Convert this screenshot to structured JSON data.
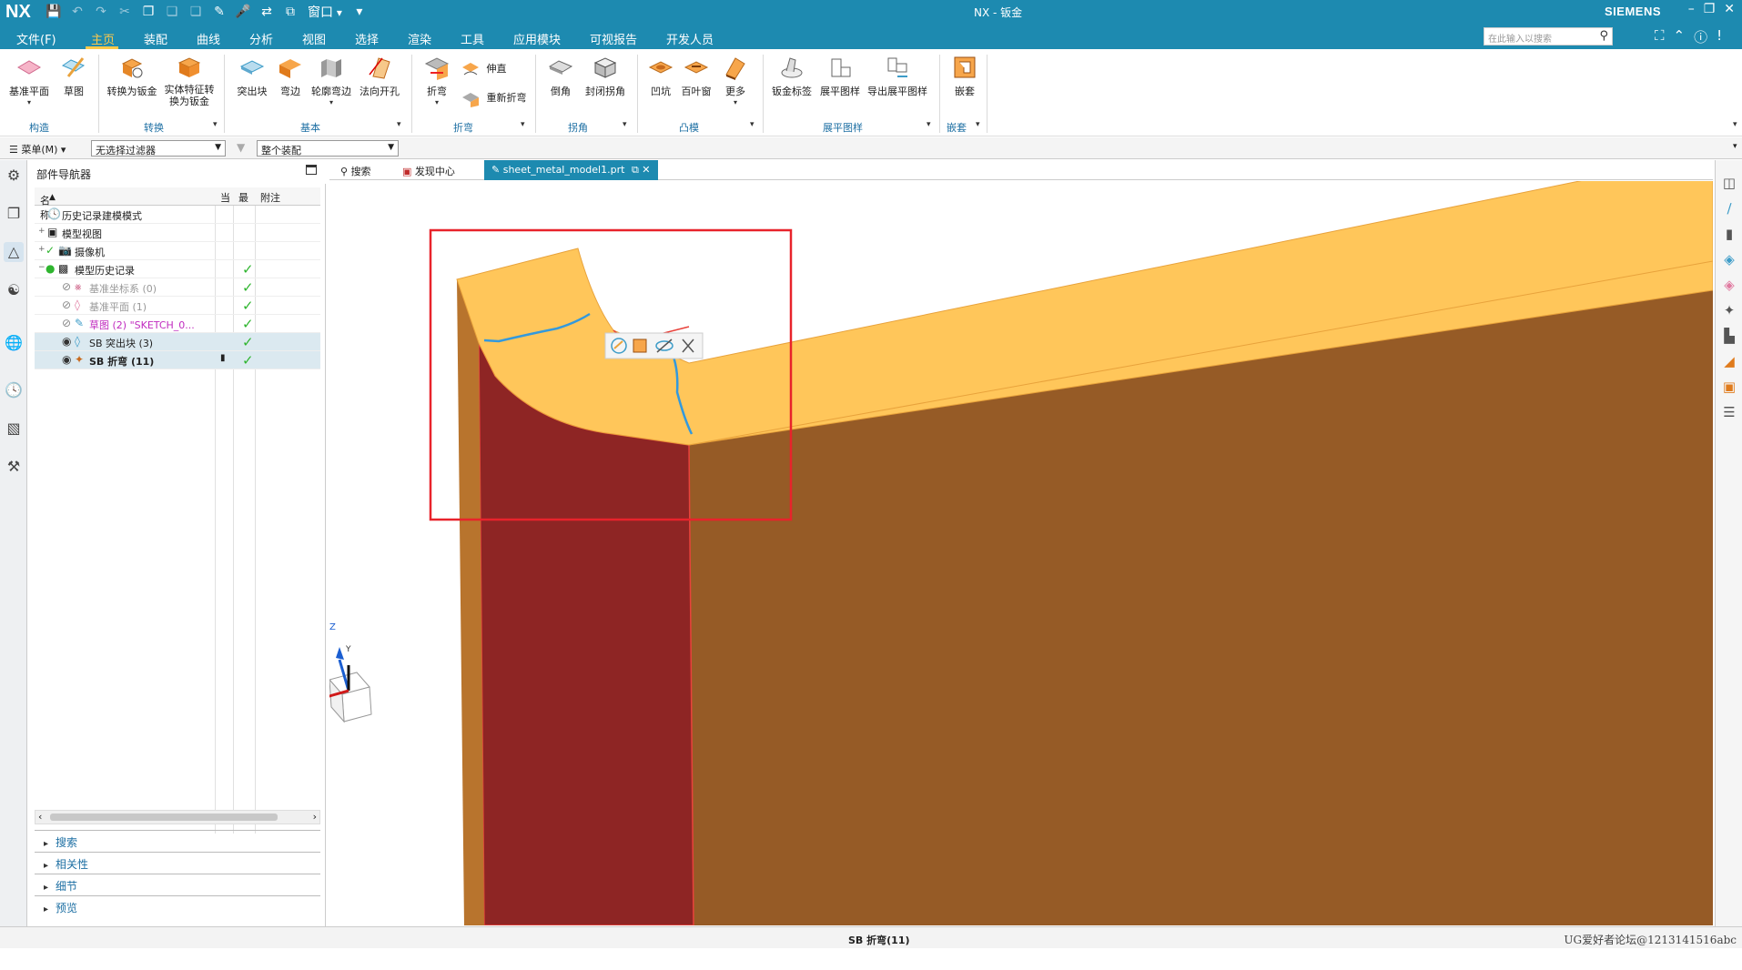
{
  "titlebar": {
    "logo": "NX",
    "title": "NX - 钣金",
    "brand": "SIEMENS",
    "window_menu": "窗口"
  },
  "menu": {
    "items": [
      "文件(F)",
      "主页",
      "装配",
      "曲线",
      "分析",
      "视图",
      "选择",
      "渲染",
      "工具",
      "应用模块",
      "可视报告",
      "开发人员"
    ],
    "active": "主页",
    "search_placeholder": "在此输入以搜索"
  },
  "ribbon": {
    "construct": {
      "datum_plane": "基准平面",
      "sketch": "草图",
      "group": "构造"
    },
    "convert": {
      "convert_to_sheet": "转换为钣金",
      "solid_feature_to_sheet": "实体特征转换为钣金",
      "group": "转换"
    },
    "basic": {
      "tab": "突出块",
      "flange": "弯边",
      "contour_flange": "轮廓弯边",
      "normal_cutout": "法向开孔",
      "group": "基本"
    },
    "bend": {
      "bend": "折弯",
      "unbend": "伸直",
      "rebend": "重新折弯",
      "group": "折弯"
    },
    "corner": {
      "chamfer": "倒角",
      "closed_corner": "封闭拐角",
      "group": "拐角"
    },
    "punch": {
      "dimple": "凹坑",
      "louver": "百叶窗",
      "more": "更多",
      "group": "凸模"
    },
    "flat": {
      "sheet_tab": "钣金标签",
      "flat_pattern": "展平图样",
      "export_flat": "导出展平图样",
      "group": "展平图样"
    },
    "nest": {
      "nest": "嵌套",
      "group": "嵌套"
    }
  },
  "filterbar": {
    "menu_label": "菜单(M)",
    "selection_filter": "无选择过滤器",
    "scope": "整个装配"
  },
  "navigator": {
    "title": "部件导航器",
    "columns": {
      "name": "名称",
      "current": "当",
      "latest": "最",
      "comment": "附注"
    },
    "rows": [
      {
        "label": "历史记录建模模式"
      },
      {
        "label": "模型视图"
      },
      {
        "label": "摄像机"
      },
      {
        "label": "模型历史记录"
      },
      {
        "label": "基准坐标系 (0)"
      },
      {
        "label": "基准平面 (1)"
      },
      {
        "label": "草图 (2) \"SKETCH_0..."
      },
      {
        "label": "SB 突出块 (3)"
      },
      {
        "label": "SB 折弯 (11)"
      }
    ],
    "panels": [
      "搜索",
      "相关性",
      "细节",
      "预览"
    ]
  },
  "tabs": {
    "search": "搜索",
    "discovery": "发现中心",
    "model": "sheet_metal_model1.prt"
  },
  "viewport": {
    "triad": {
      "z": "Z",
      "y": "Y",
      "x": "X"
    },
    "colors": {
      "top_face": "#ffc65a",
      "side_face": "#965b26",
      "selected_face": "#8e2524",
      "selection_box": "#e8232b",
      "edge_highlight": "#3399dd"
    }
  },
  "status": {
    "text": "SB 折弯(11)",
    "watermark": "UG爱好者论坛@1213141516abc"
  }
}
